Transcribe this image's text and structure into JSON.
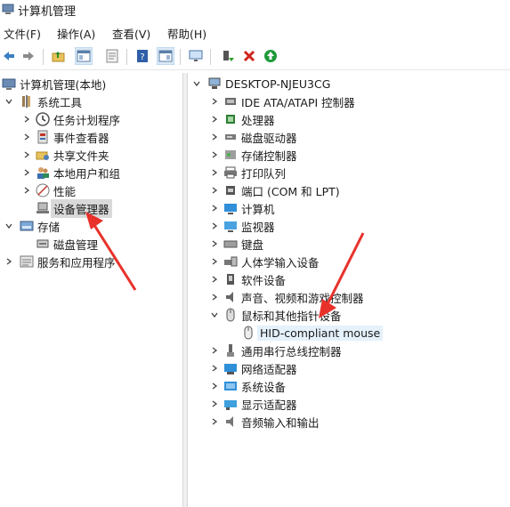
{
  "window": {
    "title": "计算机管理"
  },
  "menu": [
    "文件(F)",
    "操作(A)",
    "查看(V)",
    "帮助(H)"
  ],
  "toolbar_icons": [
    "back-icon",
    "forward-icon",
    "up-folder-icon",
    "show-tree-icon",
    "properties-icon",
    "help-icon",
    "show-pane-icon",
    "monitor-icon",
    "enable-device-icon",
    "uninstall-icon",
    "update-driver-icon"
  ],
  "left_tree": {
    "root": "计算机管理(本地)",
    "system_tools": "系统工具",
    "task_scheduler": "任务计划程序",
    "event_viewer": "事件查看器",
    "shared_folders": "共享文件夹",
    "local_users": "本地用户和组",
    "performance": "性能",
    "device_manager": "设备管理器",
    "storage": "存储",
    "disk_management": "磁盘管理",
    "services_apps": "服务和应用程序"
  },
  "device_tree": {
    "root": "DESKTOP-NJEU3CG",
    "categories": [
      "IDE ATA/ATAPI 控制器",
      "处理器",
      "磁盘驱动器",
      "存储控制器",
      "打印队列",
      "端口 (COM 和 LPT)",
      "计算机",
      "监视器",
      "键盘",
      "人体学输入设备",
      "软件设备",
      "声音、视频和游戏控制器",
      "鼠标和其他指针设备",
      "通用串行总线控制器",
      "网络适配器",
      "系统设备",
      "显示适配器",
      "音频输入和输出"
    ],
    "mouse_child": "HID-compliant mouse"
  },
  "colors": {
    "annotation_arrow": "#e8312a",
    "selection": "#d9d9d9",
    "hid_highlight": "#e5f1fb"
  }
}
